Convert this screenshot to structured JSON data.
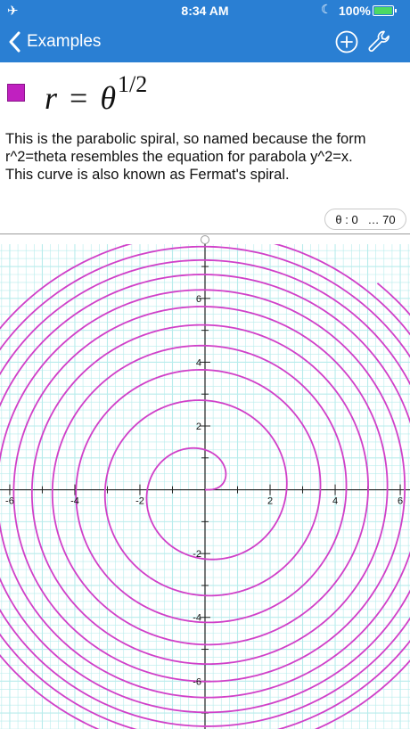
{
  "status_bar": {
    "time": "8:34 AM",
    "battery": "100%",
    "icons": [
      "airplane-icon",
      "moon-icon",
      "battery-icon"
    ]
  },
  "nav": {
    "back_label": "Examples",
    "icons": [
      "chevron-left-icon",
      "add-icon",
      "wrench-icon"
    ]
  },
  "formula": {
    "lhs": "r",
    "op": "=",
    "rhs": "θ",
    "exponent": "1/2",
    "color": "#c020c0"
  },
  "description": {
    "line1": "This is the parabolic spiral, so named because the form",
    "line2": "r^2=theta resembles the equation for parabola y^2=x.",
    "line3": "This curve is also known as Fermat's spiral."
  },
  "range": {
    "text": "θ : 0   … 70"
  },
  "chart_data": {
    "type": "line",
    "equation": "r = theta^(1/2)",
    "parametric": "polar",
    "theta_range": [
      0,
      70
    ],
    "xlim": [
      -6.3,
      6.3
    ],
    "ylim": [
      -7.5,
      7.7
    ],
    "x_ticks": [
      "-6",
      "-4",
      "-2",
      "2",
      "4",
      "6"
    ],
    "y_ticks": [
      "6",
      "4",
      "2",
      "-2",
      "-4",
      "-6"
    ],
    "grid": true,
    "curve_color": "#d040c8",
    "grid_color": "#b8ecec",
    "axis_color": "#222222"
  }
}
